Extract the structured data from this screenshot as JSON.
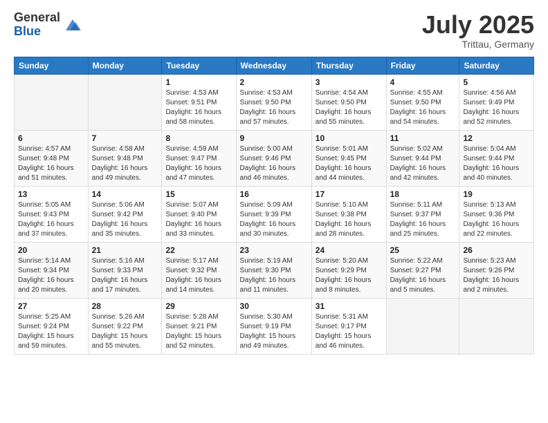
{
  "logo": {
    "general": "General",
    "blue": "Blue"
  },
  "title": "July 2025",
  "location": "Trittau, Germany",
  "headers": [
    "Sunday",
    "Monday",
    "Tuesday",
    "Wednesday",
    "Thursday",
    "Friday",
    "Saturday"
  ],
  "weeks": [
    [
      {
        "day": "",
        "sunrise": "",
        "sunset": "",
        "daylight": ""
      },
      {
        "day": "",
        "sunrise": "",
        "sunset": "",
        "daylight": ""
      },
      {
        "day": "1",
        "sunrise": "Sunrise: 4:53 AM",
        "sunset": "Sunset: 9:51 PM",
        "daylight": "Daylight: 16 hours and 58 minutes."
      },
      {
        "day": "2",
        "sunrise": "Sunrise: 4:53 AM",
        "sunset": "Sunset: 9:50 PM",
        "daylight": "Daylight: 16 hours and 57 minutes."
      },
      {
        "day": "3",
        "sunrise": "Sunrise: 4:54 AM",
        "sunset": "Sunset: 9:50 PM",
        "daylight": "Daylight: 16 hours and 55 minutes."
      },
      {
        "day": "4",
        "sunrise": "Sunrise: 4:55 AM",
        "sunset": "Sunset: 9:50 PM",
        "daylight": "Daylight: 16 hours and 54 minutes."
      },
      {
        "day": "5",
        "sunrise": "Sunrise: 4:56 AM",
        "sunset": "Sunset: 9:49 PM",
        "daylight": "Daylight: 16 hours and 52 minutes."
      }
    ],
    [
      {
        "day": "6",
        "sunrise": "Sunrise: 4:57 AM",
        "sunset": "Sunset: 9:48 PM",
        "daylight": "Daylight: 16 hours and 51 minutes."
      },
      {
        "day": "7",
        "sunrise": "Sunrise: 4:58 AM",
        "sunset": "Sunset: 9:48 PM",
        "daylight": "Daylight: 16 hours and 49 minutes."
      },
      {
        "day": "8",
        "sunrise": "Sunrise: 4:59 AM",
        "sunset": "Sunset: 9:47 PM",
        "daylight": "Daylight: 16 hours and 47 minutes."
      },
      {
        "day": "9",
        "sunrise": "Sunrise: 5:00 AM",
        "sunset": "Sunset: 9:46 PM",
        "daylight": "Daylight: 16 hours and 46 minutes."
      },
      {
        "day": "10",
        "sunrise": "Sunrise: 5:01 AM",
        "sunset": "Sunset: 9:45 PM",
        "daylight": "Daylight: 16 hours and 44 minutes."
      },
      {
        "day": "11",
        "sunrise": "Sunrise: 5:02 AM",
        "sunset": "Sunset: 9:44 PM",
        "daylight": "Daylight: 16 hours and 42 minutes."
      },
      {
        "day": "12",
        "sunrise": "Sunrise: 5:04 AM",
        "sunset": "Sunset: 9:44 PM",
        "daylight": "Daylight: 16 hours and 40 minutes."
      }
    ],
    [
      {
        "day": "13",
        "sunrise": "Sunrise: 5:05 AM",
        "sunset": "Sunset: 9:43 PM",
        "daylight": "Daylight: 16 hours and 37 minutes."
      },
      {
        "day": "14",
        "sunrise": "Sunrise: 5:06 AM",
        "sunset": "Sunset: 9:42 PM",
        "daylight": "Daylight: 16 hours and 35 minutes."
      },
      {
        "day": "15",
        "sunrise": "Sunrise: 5:07 AM",
        "sunset": "Sunset: 9:40 PM",
        "daylight": "Daylight: 16 hours and 33 minutes."
      },
      {
        "day": "16",
        "sunrise": "Sunrise: 5:09 AM",
        "sunset": "Sunset: 9:39 PM",
        "daylight": "Daylight: 16 hours and 30 minutes."
      },
      {
        "day": "17",
        "sunrise": "Sunrise: 5:10 AM",
        "sunset": "Sunset: 9:38 PM",
        "daylight": "Daylight: 16 hours and 28 minutes."
      },
      {
        "day": "18",
        "sunrise": "Sunrise: 5:11 AM",
        "sunset": "Sunset: 9:37 PM",
        "daylight": "Daylight: 16 hours and 25 minutes."
      },
      {
        "day": "19",
        "sunrise": "Sunrise: 5:13 AM",
        "sunset": "Sunset: 9:36 PM",
        "daylight": "Daylight: 16 hours and 22 minutes."
      }
    ],
    [
      {
        "day": "20",
        "sunrise": "Sunrise: 5:14 AM",
        "sunset": "Sunset: 9:34 PM",
        "daylight": "Daylight: 16 hours and 20 minutes."
      },
      {
        "day": "21",
        "sunrise": "Sunrise: 5:16 AM",
        "sunset": "Sunset: 9:33 PM",
        "daylight": "Daylight: 16 hours and 17 minutes."
      },
      {
        "day": "22",
        "sunrise": "Sunrise: 5:17 AM",
        "sunset": "Sunset: 9:32 PM",
        "daylight": "Daylight: 16 hours and 14 minutes."
      },
      {
        "day": "23",
        "sunrise": "Sunrise: 5:19 AM",
        "sunset": "Sunset: 9:30 PM",
        "daylight": "Daylight: 16 hours and 11 minutes."
      },
      {
        "day": "24",
        "sunrise": "Sunrise: 5:20 AM",
        "sunset": "Sunset: 9:29 PM",
        "daylight": "Daylight: 16 hours and 8 minutes."
      },
      {
        "day": "25",
        "sunrise": "Sunrise: 5:22 AM",
        "sunset": "Sunset: 9:27 PM",
        "daylight": "Daylight: 16 hours and 5 minutes."
      },
      {
        "day": "26",
        "sunrise": "Sunrise: 5:23 AM",
        "sunset": "Sunset: 9:26 PM",
        "daylight": "Daylight: 16 hours and 2 minutes."
      }
    ],
    [
      {
        "day": "27",
        "sunrise": "Sunrise: 5:25 AM",
        "sunset": "Sunset: 9:24 PM",
        "daylight": "Daylight: 15 hours and 59 minutes."
      },
      {
        "day": "28",
        "sunrise": "Sunrise: 5:26 AM",
        "sunset": "Sunset: 9:22 PM",
        "daylight": "Daylight: 15 hours and 55 minutes."
      },
      {
        "day": "29",
        "sunrise": "Sunrise: 5:28 AM",
        "sunset": "Sunset: 9:21 PM",
        "daylight": "Daylight: 15 hours and 52 minutes."
      },
      {
        "day": "30",
        "sunrise": "Sunrise: 5:30 AM",
        "sunset": "Sunset: 9:19 PM",
        "daylight": "Daylight: 15 hours and 49 minutes."
      },
      {
        "day": "31",
        "sunrise": "Sunrise: 5:31 AM",
        "sunset": "Sunset: 9:17 PM",
        "daylight": "Daylight: 15 hours and 46 minutes."
      },
      {
        "day": "",
        "sunrise": "",
        "sunset": "",
        "daylight": ""
      },
      {
        "day": "",
        "sunrise": "",
        "sunset": "",
        "daylight": ""
      }
    ]
  ]
}
